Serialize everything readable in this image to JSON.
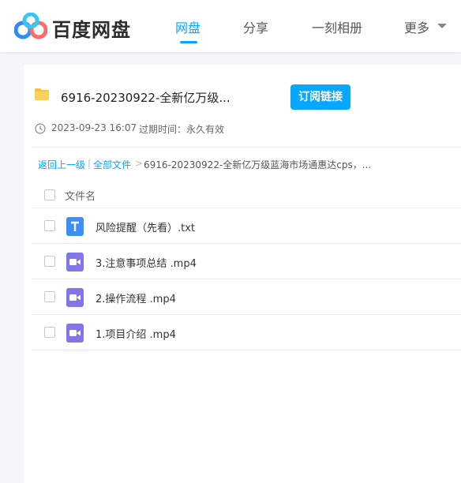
{
  "header": {
    "brand": "百度网盘",
    "nav": [
      {
        "label": "网盘"
      },
      {
        "label": "分享"
      },
      {
        "label": "一刻相册"
      },
      {
        "label": "更多"
      }
    ],
    "accent_color": "#06a7ff"
  },
  "share": {
    "title": "6916-20230922-全新亿万级...",
    "subscribe_label": "订阅链接",
    "date": "2023-09-23 16:07",
    "expire": "过期时间：永久有效"
  },
  "breadcrumb": {
    "back": "返回上一级",
    "sep1": "|",
    "all_files": "全部文件",
    "sep2": ">",
    "current": "6916-20230922-全新亿万级蓝海市场通惠达cps，..."
  },
  "list": {
    "column_header": "文件名",
    "files": [
      {
        "name": "风险提醒（先看）.txt",
        "icon": "txt-file-icon"
      },
      {
        "name": "3.注意事项总结 .mp4",
        "icon": "video-file-icon"
      },
      {
        "name": "2.操作流程 .mp4",
        "icon": "video-file-icon"
      },
      {
        "name": "1.项目介绍 .mp4",
        "icon": "video-file-icon"
      }
    ]
  }
}
